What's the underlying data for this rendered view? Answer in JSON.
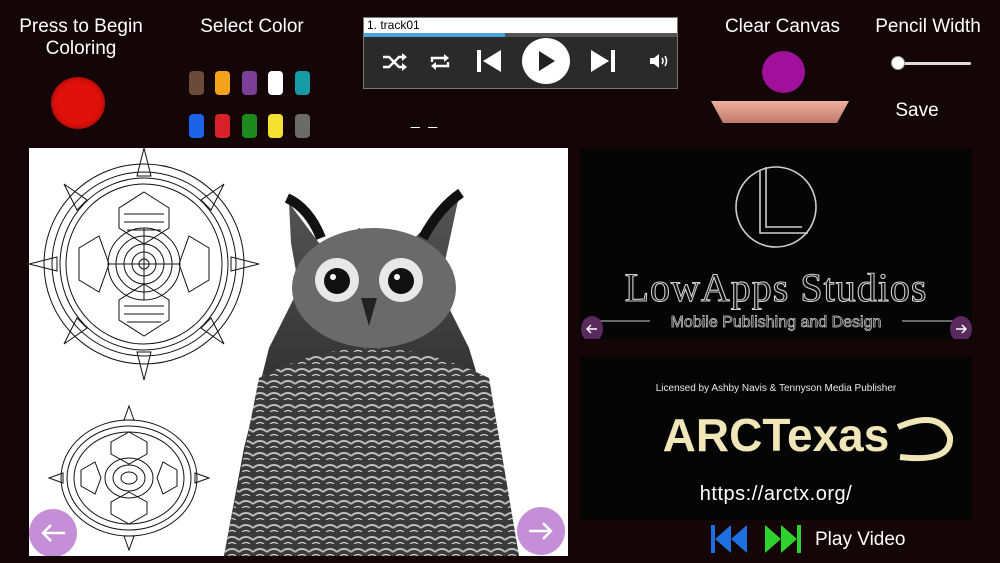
{
  "controls": {
    "begin_label": "Press to Begin Coloring",
    "select_color_label": "Select Color",
    "clear_label": "Clear Canvas",
    "pencil_width_label": "Pencil Width",
    "save_label": "Save",
    "status_text": "_ _",
    "begin_color": "#e0100a",
    "clear_color": "#a0109a",
    "pencil_width_fraction": 0.05
  },
  "swatches": [
    {
      "name": "brown",
      "color": "#6b4a3a"
    },
    {
      "name": "orange",
      "color": "#f3a21b"
    },
    {
      "name": "purple",
      "color": "#7b3f98"
    },
    {
      "name": "white",
      "color": "#ffffff"
    },
    {
      "name": "teal",
      "color": "#159aa6"
    },
    {
      "name": "blue",
      "color": "#1d63e8"
    },
    {
      "name": "red",
      "color": "#d8202a"
    },
    {
      "name": "green",
      "color": "#1e8a1e"
    },
    {
      "name": "yellow",
      "color": "#f4e030"
    },
    {
      "name": "gray",
      "color": "#6a6a6a"
    }
  ],
  "player": {
    "track": "1.  track01",
    "progress": 0.45
  },
  "logo_ad": {
    "title": "LowApps Studios",
    "subtitle": "Mobile Publishing and Design"
  },
  "arc_ad": {
    "license": "Licensed by Ashby Navis & Tennyson Media Publisher",
    "brand": "ARCTexas",
    "url": "https://arctx.org/"
  },
  "video": {
    "label": "Play Video",
    "rewind_color": "#1e6fe0",
    "forward_color": "#2ed12e"
  }
}
